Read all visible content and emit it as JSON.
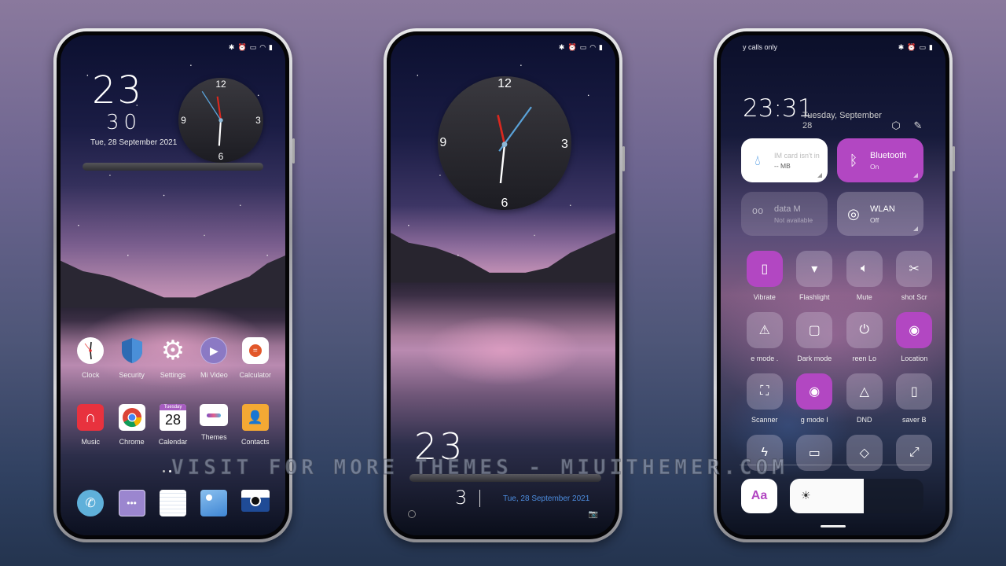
{
  "status_icons": [
    "bluetooth-icon",
    "alarm-icon",
    "no-sim-icon",
    "wifi-icon",
    "battery-icon"
  ],
  "phone_home": {
    "clock_hour": "23",
    "clock_minute": "30",
    "date": "Tue, 28 September 2021",
    "analog_clock": {
      "numbers": [
        "12",
        "3",
        "6",
        "9"
      ],
      "hour": 23,
      "minute": 31,
      "second": 52
    },
    "apps_row1": [
      {
        "label": "Clock",
        "icon": "clock-icon"
      },
      {
        "label": "Security",
        "icon": "shield-icon"
      },
      {
        "label": "Settings",
        "icon": "gear-icon"
      },
      {
        "label": "Mi Video",
        "icon": "play-icon"
      },
      {
        "label": "Calculator",
        "icon": "calculator-icon"
      }
    ],
    "apps_row2": [
      {
        "label": "Music",
        "icon": "headphones-icon"
      },
      {
        "label": "Chrome",
        "icon": "chrome-icon"
      },
      {
        "label": "Calendar",
        "icon": "calendar-icon",
        "calendar_day": "Tuesday",
        "calendar_date": "28"
      },
      {
        "label": "Themes",
        "icon": "themes-icon"
      },
      {
        "label": "Contacts",
        "icon": "contacts-icon"
      }
    ],
    "dock": [
      {
        "name": "phone",
        "icon": "phone-icon"
      },
      {
        "name": "messages",
        "icon": "message-icon"
      },
      {
        "name": "notes",
        "icon": "notes-icon"
      },
      {
        "name": "gallery",
        "icon": "gallery-icon"
      },
      {
        "name": "camera",
        "icon": "camera-icon"
      }
    ],
    "page_count": 2,
    "active_page": 2
  },
  "phone_lock": {
    "analog_clock": {
      "numbers": [
        "12",
        "3",
        "6",
        "9"
      ]
    },
    "hour": "23",
    "minute": "3",
    "date": "Tue, 28 September 2021"
  },
  "phone_control": {
    "carrier_text": "y calls only",
    "time": "23:31",
    "date": "Tuesday, September 28",
    "big_tiles": [
      {
        "title": "IM card isn't in",
        "subtitle": "-- MB",
        "icon": "water-drop-icon",
        "state": "white"
      },
      {
        "title": "Bluetooth",
        "subtitle": "On",
        "icon": "bluetooth-icon",
        "state": "on"
      },
      {
        "title": "data       M",
        "subtitle": "Not available",
        "icon": "mobile-data-icon",
        "state": "disabled"
      },
      {
        "title": "WLAN",
        "subtitle": "Off",
        "icon": "wifi-icon",
        "state": "off"
      }
    ],
    "small_tiles": [
      {
        "label": "Vibrate",
        "icon": "vibrate-icon",
        "on": true
      },
      {
        "label": "Flashlight",
        "icon": "flashlight-icon",
        "on": false
      },
      {
        "label": "Mute",
        "icon": "mute-icon",
        "on": false
      },
      {
        "label": "shot   Scr",
        "icon": "scissors-icon",
        "on": false
      },
      {
        "label": "e mode   .",
        "icon": "airplane-icon",
        "on": false
      },
      {
        "label": "Dark mode",
        "icon": "dark-mode-icon",
        "on": false
      },
      {
        "label": "reen   Lo",
        "icon": "power-icon",
        "on": false
      },
      {
        "label": "Location",
        "icon": "location-icon",
        "on": true
      },
      {
        "label": "Scanner",
        "icon": "scanner-icon",
        "on": false
      },
      {
        "label": "g mode   I",
        "icon": "eye-icon",
        "on": true
      },
      {
        "label": "DND",
        "icon": "dnd-icon",
        "on": false
      },
      {
        "label": "saver   B",
        "icon": "battery-saver-icon",
        "on": false
      },
      {
        "label": "",
        "icon": "lightning-icon",
        "on": false
      },
      {
        "label": "",
        "icon": "cast-icon",
        "on": false
      },
      {
        "label": "",
        "icon": "mi-share-icon",
        "on": false
      },
      {
        "label": "",
        "icon": "fullscreen-icon",
        "on": false
      }
    ],
    "font_button": "Aa",
    "brightness_percent": 55
  },
  "watermark": "VISIT FOR MORE THEMES - MIUITHEMER.COM"
}
